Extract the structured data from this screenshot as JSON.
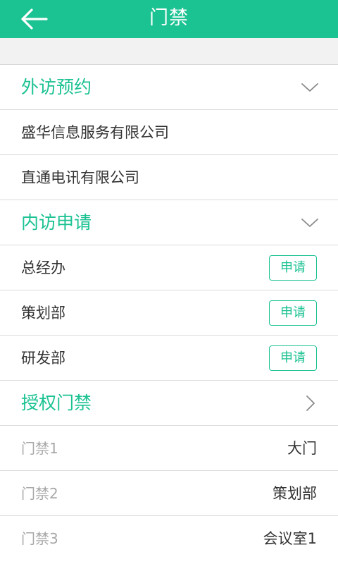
{
  "header": {
    "title": "门禁"
  },
  "sections": {
    "visit": {
      "title": "外访预约",
      "items": [
        {
          "label": "盛华信息服务有限公司"
        },
        {
          "label": "直通电讯有限公司"
        }
      ]
    },
    "internal": {
      "title": "内访申请",
      "apply_label": "申请",
      "items": [
        {
          "label": "总经办"
        },
        {
          "label": "策划部"
        },
        {
          "label": "研发部"
        }
      ]
    },
    "auth": {
      "title": "授权门禁",
      "items": [
        {
          "label": "门禁1",
          "value": "大门"
        },
        {
          "label": "门禁2",
          "value": "策划部"
        },
        {
          "label": "门禁3",
          "value": "会议室1"
        }
      ]
    }
  },
  "icons": {
    "back": "arrow-left-icon",
    "expand": "chevron-down-icon",
    "navigate": "chevron-right-icon"
  },
  "colors": {
    "accent": "#1bc292",
    "text": "#333333",
    "muted": "#a8a8a8"
  }
}
